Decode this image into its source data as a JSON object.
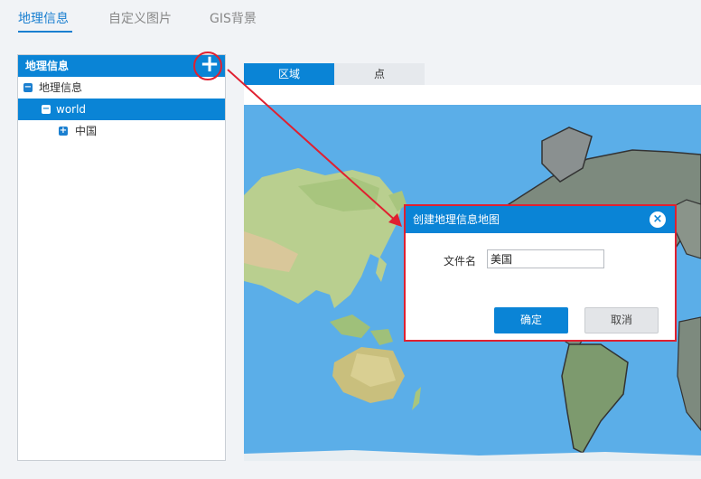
{
  "top_tabs": [
    {
      "label": "地理信息",
      "active": true
    },
    {
      "label": "自定义图片",
      "active": false
    },
    {
      "label": "GIS背景",
      "active": false
    }
  ],
  "tree": {
    "title": "地理信息",
    "add_icon": "plus-icon",
    "items": [
      {
        "label": "地理信息",
        "toggle": "−",
        "selected": false
      },
      {
        "label": "world",
        "toggle": "−",
        "selected": true
      },
      {
        "label": "中国",
        "toggle": "+",
        "selected": false
      }
    ]
  },
  "map_tabs": [
    {
      "label": "区域",
      "active": true
    },
    {
      "label": "点",
      "active": false
    }
  ],
  "dialog": {
    "title": "创建地理信息地图",
    "close_icon": "×",
    "field_label": "文件名",
    "field_value": "美国",
    "ok_label": "确定",
    "cancel_label": "取消"
  },
  "colors": {
    "accent": "#0a84d6",
    "highlight": "#e02030",
    "ocean": "#5baee8"
  }
}
